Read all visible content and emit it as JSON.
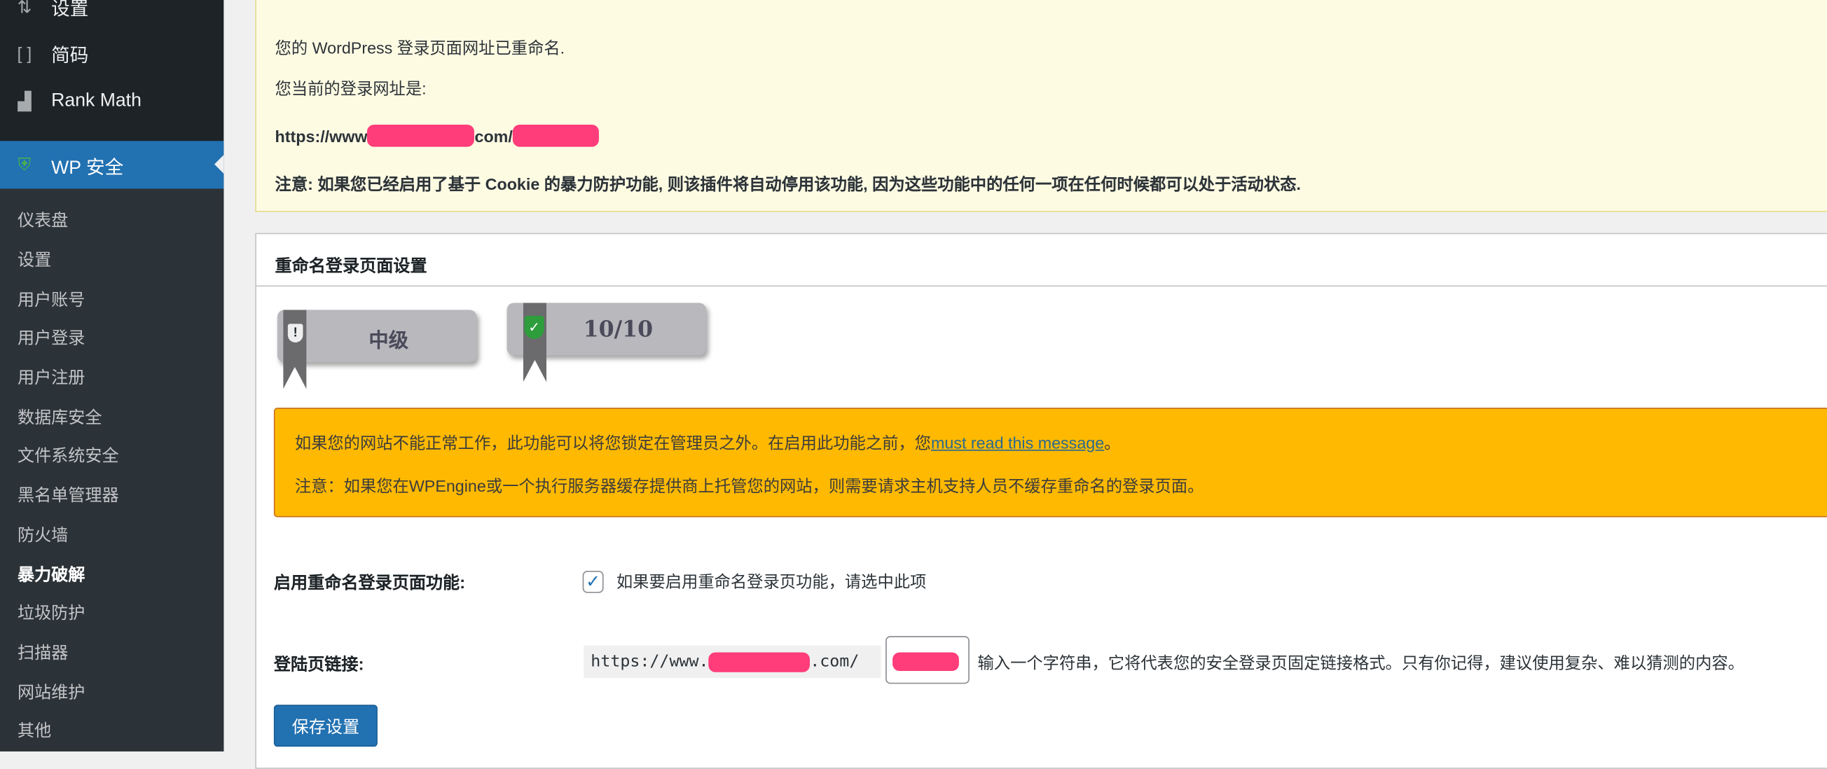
{
  "sidebar": {
    "top_items": [
      {
        "label": "设置",
        "icon": "settings-sliders-icon"
      },
      {
        "label": "简码",
        "icon": "shortcode-brackets-icon"
      },
      {
        "label": "Rank Math",
        "icon": "rank-math-icon"
      }
    ],
    "active": {
      "label": "WP 安全",
      "icon": "shield-check-icon"
    },
    "submenu": [
      "仪表盘",
      "设置",
      "用户账号",
      "用户登录",
      "用户注册",
      "数据库安全",
      "文件系统安全",
      "黑名单管理器",
      "防火墙",
      "暴力破解",
      "垃圾防护",
      "扫描器",
      "网站维护",
      "其他"
    ],
    "current_submenu": "暴力破解"
  },
  "notice": {
    "line1": "您的 WordPress 登录页面网址已重命名.",
    "line2": "您当前的登录网址是:",
    "url_prefix": "https://www",
    "url_mid": "com/",
    "note": "注意: 如果您已经启用了基于 Cookie 的暴力防护功能, 则该插件将自动停用该功能, 因为这些功能中的任何一项在任何时候都可以处于活动状态."
  },
  "panel": {
    "title": "重命名登录页面设置",
    "badges": [
      {
        "text": "中级",
        "icon": "shield-exclamation-icon"
      },
      {
        "text": "10/10",
        "icon": "shield-check-green-icon"
      }
    ],
    "warning": {
      "line1_text": "如果您的网站不能正常工作，此功能可以将您锁定在管理员之外。在启用此功能之前，您",
      "line1_link": "must read this message",
      "line1_end": "。",
      "line2": "注意：如果您在WPEngine或一个执行服务器缓存提供商上托管您的网站，则需要请求主机支持人员不缓存重命名的登录页面。"
    },
    "enable_label": "启用重命名登录页面功能:",
    "enable_checked": true,
    "enable_desc": "如果要启用重命名登录页功能，请选中此项",
    "slug_label": "登陆页链接:",
    "slug_prefix_start": "https://www.",
    "slug_prefix_end": ".com/",
    "slug_hint": "输入一个字符串，它将代表您的安全登录页固定链接格式。只有你记得，建议使用复杂、难以猜测的内容。",
    "save_label": "保存设置"
  },
  "colors": {
    "accent": "#2271b1",
    "redaction": "#ff3d7a",
    "warning": "#ffb900",
    "notice_bg": "#fefbe3"
  }
}
